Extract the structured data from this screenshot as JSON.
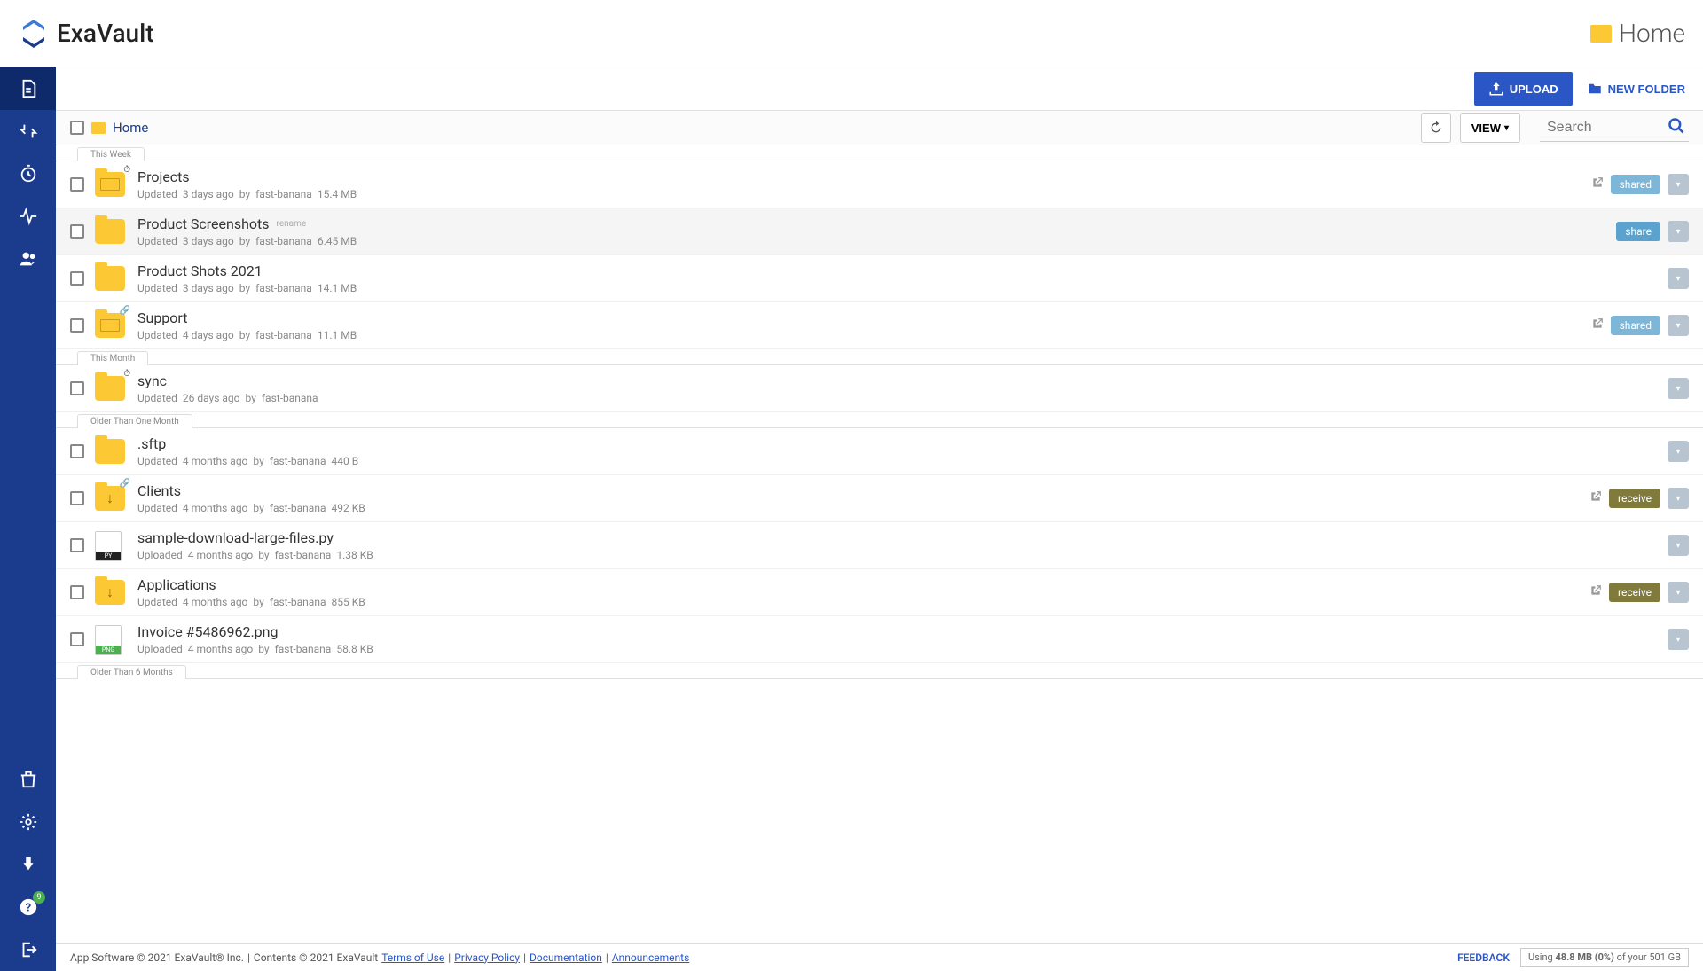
{
  "brand": {
    "name": "ExaVault"
  },
  "header": {
    "page_name": "Home"
  },
  "toolbar": {
    "upload": "UPLOAD",
    "new_folder": "NEW FOLDER"
  },
  "crumb": {
    "home": "Home",
    "view_label": "VIEW",
    "search_placeholder": "Search"
  },
  "sidebar": {
    "help_badge": "9"
  },
  "sections": [
    {
      "label": "This Week",
      "items": [
        {
          "id": "projects",
          "name": "Projects",
          "kind": "folder",
          "special": true,
          "icon_badge": "clock",
          "action": "Updated",
          "when": "3 days ago",
          "by": "fast-banana",
          "size": "15.4 MB",
          "ext_link": true,
          "badge": "shared"
        },
        {
          "id": "prodscreens",
          "name": "Product Screenshots",
          "kind": "folder",
          "rename_hint": "rename",
          "hovered": true,
          "action": "Updated",
          "when": "3 days ago",
          "by": "fast-banana",
          "size": "6.45 MB",
          "badge": "share"
        },
        {
          "id": "prodshots",
          "name": "Product Shots 2021",
          "kind": "folder",
          "action": "Updated",
          "when": "3 days ago",
          "by": "fast-banana",
          "size": "14.1 MB"
        },
        {
          "id": "support",
          "name": "Support",
          "kind": "folder",
          "special": true,
          "icon_badge": "link",
          "action": "Updated",
          "when": "4 days ago",
          "by": "fast-banana",
          "size": "11.1 MB",
          "ext_link": true,
          "badge": "shared"
        }
      ]
    },
    {
      "label": "This Month",
      "items": [
        {
          "id": "sync",
          "name": "sync",
          "kind": "folder",
          "icon_badge": "clock",
          "action": "Updated",
          "when": "26 days ago",
          "by": "fast-banana",
          "size": ""
        }
      ]
    },
    {
      "label": "Older Than One Month",
      "items": [
        {
          "id": "sftp",
          "name": ".sftp",
          "kind": "folder",
          "action": "Updated",
          "when": "4 months ago",
          "by": "fast-banana",
          "size": "440 B"
        },
        {
          "id": "clients",
          "name": "Clients",
          "kind": "folder",
          "download": true,
          "icon_badge": "link",
          "action": "Updated",
          "when": "4 months ago",
          "by": "fast-banana",
          "size": "492 KB",
          "ext_link": true,
          "badge": "receive"
        },
        {
          "id": "sample",
          "name": "sample-download-large-files.py",
          "kind": "file",
          "ext": "PY",
          "action": "Uploaded",
          "when": "4 months ago",
          "by": "fast-banana",
          "size": "1.38 KB"
        },
        {
          "id": "apps",
          "name": "Applications",
          "kind": "folder",
          "download": true,
          "action": "Updated",
          "when": "4 months ago",
          "by": "fast-banana",
          "size": "855 KB",
          "ext_link": true,
          "badge": "receive"
        },
        {
          "id": "invoice",
          "name": "Invoice #5486962.png",
          "kind": "file",
          "ext": "PNG",
          "png": true,
          "action": "Uploaded",
          "when": "4 months ago",
          "by": "fast-banana",
          "size": "58.8 KB"
        }
      ]
    },
    {
      "label": "Older Than 6 Months",
      "items": []
    }
  ],
  "labels": {
    "by": "by"
  },
  "footer": {
    "copyright_app": "App Software © 2021 ExaVault® Inc.",
    "copyright_content": "Contents © 2021 ExaVault",
    "terms": "Terms of Use",
    "privacy": "Privacy Policy",
    "docs": "Documentation",
    "announce": "Announcements",
    "feedback": "FEEDBACK",
    "usage_prefix": "Using",
    "usage_used": "48.8 MB",
    "usage_pct": "(0%)",
    "usage_of": "of your",
    "usage_total": "501 GB"
  }
}
